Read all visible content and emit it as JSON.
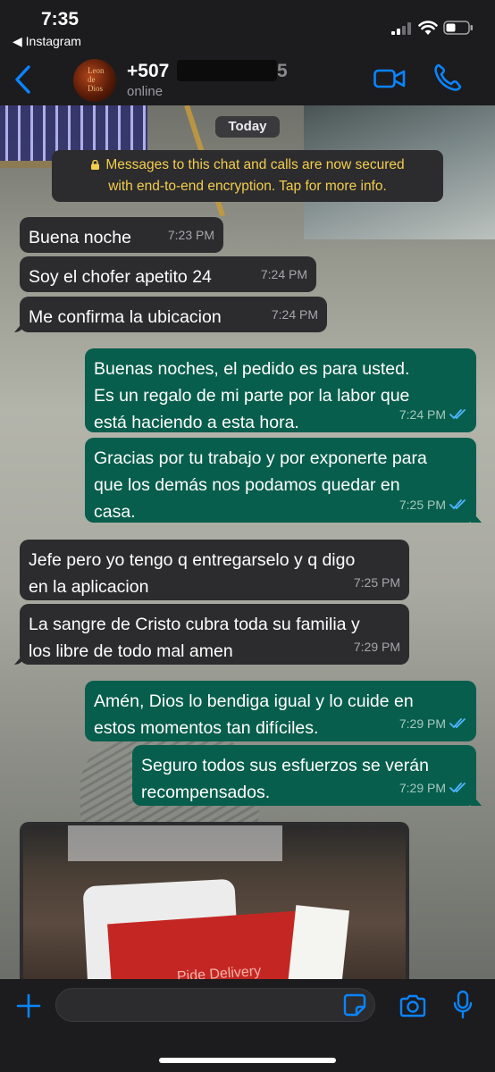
{
  "status_bar": {
    "time": "7:35",
    "back_app": "◀ Instagram"
  },
  "header": {
    "contact_prefix": "+507",
    "contact_suffix": "5",
    "presence": "online",
    "accent_color": "#0a84ff"
  },
  "chat": {
    "day_label": "Today",
    "encryption_notice": {
      "line1": "Messages to this chat and calls are now secured",
      "line2": "with end-to-end encryption. Tap for more info."
    },
    "messages": [
      {
        "direction": "in",
        "text": "Buena noche",
        "time": "7:23 PM"
      },
      {
        "direction": "in",
        "text": "Soy el chofer apetito 24",
        "time": "7:24 PM"
      },
      {
        "direction": "in",
        "text": "Me confirma la ubicacion",
        "time": "7:24 PM"
      },
      {
        "direction": "out",
        "text": "Buenas noches, el pedido es para usted.\nEs un regalo de mi parte por la labor que\nestá haciendo a esta hora.",
        "time": "7:24 PM",
        "read": true
      },
      {
        "direction": "out",
        "text": "Gracias por tu trabajo y por exponerte para\nque los demás nos podamos quedar en\ncasa.",
        "time": "7:25 PM",
        "read": true
      },
      {
        "direction": "in",
        "text": "Jefe pero yo tengo q entregarselo y q digo\nen la aplicacion",
        "time": "7:25 PM"
      },
      {
        "direction": "in",
        "text": "La sangre de Cristo cubra toda su familia y\nlos libre de todo mal amen",
        "time": "7:29 PM"
      },
      {
        "direction": "out",
        "text": "Amén, Dios lo bendiga igual y lo cuide en\nestos momentos tan difíciles.",
        "time": "7:29 PM",
        "read": true
      },
      {
        "direction": "out",
        "text": "Seguro todos sus esfuerzos se verán\nrecompensados.",
        "time": "7:29 PM",
        "read": true
      }
    ],
    "photo_caption_visible": "Pide Delivery"
  },
  "input_bar": {
    "placeholder": ""
  },
  "colors": {
    "incoming_bubble": "#2c2c2e",
    "outgoing_bubble": "#075e4c",
    "read_ticks": "#4fb6ff",
    "encryption_text": "#f3cd4e"
  }
}
